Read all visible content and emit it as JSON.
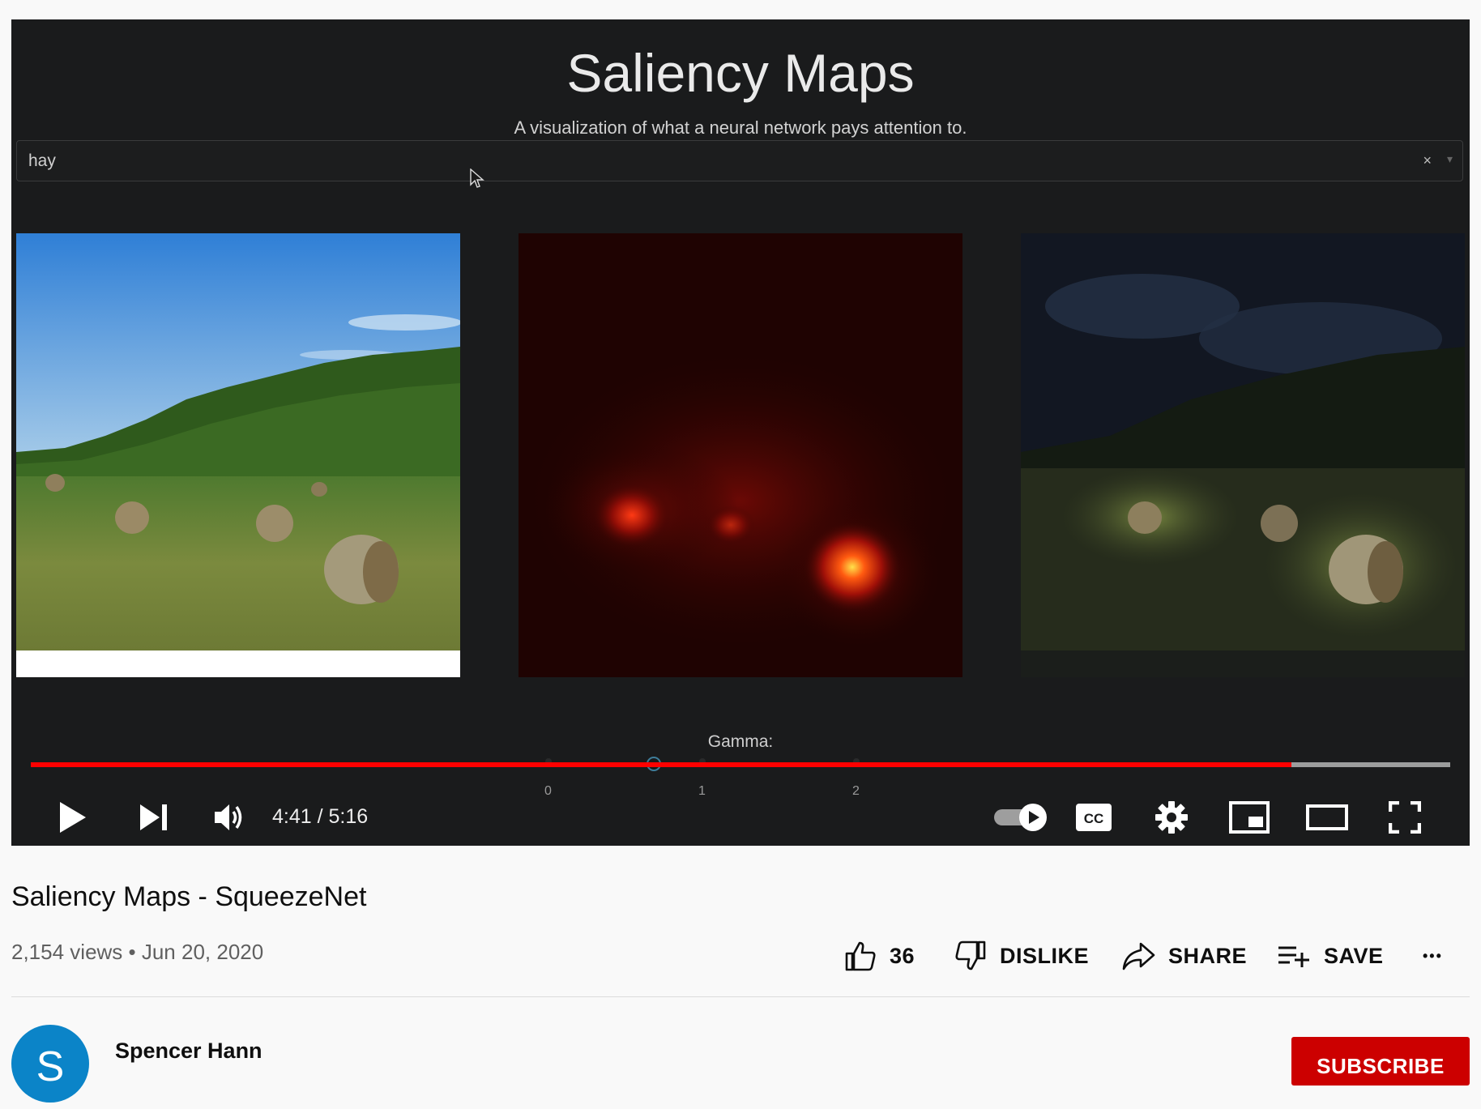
{
  "saliency_app": {
    "title": "Saliency Maps",
    "subtitle": "A visualization of what a neural network pays attention to.",
    "class_select": {
      "value": "hay",
      "clear_label": "×",
      "arrow_label": "▾"
    },
    "gamma": {
      "label": "Gamma:",
      "ticks": [
        "0",
        "1",
        "2"
      ],
      "value": 0.7
    }
  },
  "player": {
    "time": "4:41 / 5:16",
    "progress_fraction": 0.888,
    "icons": [
      "play-icon",
      "next-icon",
      "volume-icon",
      "autoplay-toggle-icon",
      "captions-icon",
      "settings-icon",
      "miniplayer-icon",
      "theater-icon",
      "fullscreen-icon"
    ]
  },
  "video": {
    "title": "Saliency Maps - SqueezeNet",
    "meta": "2,154 views • Jun 20, 2020"
  },
  "actions": {
    "like_count": "36",
    "dislike_label": "DISLIKE",
    "share_label": "SHARE",
    "save_label": "SAVE",
    "more_label": "•••"
  },
  "channel": {
    "name": "Spencer Hann",
    "avatar_letter": "S",
    "subscribe_label": "SUBSCRIBE"
  },
  "colors": {
    "progress": "#ff0000",
    "subscribe": "#cc0000",
    "avatar": "#0b84c8",
    "player_bg": "#1a1b1c"
  }
}
